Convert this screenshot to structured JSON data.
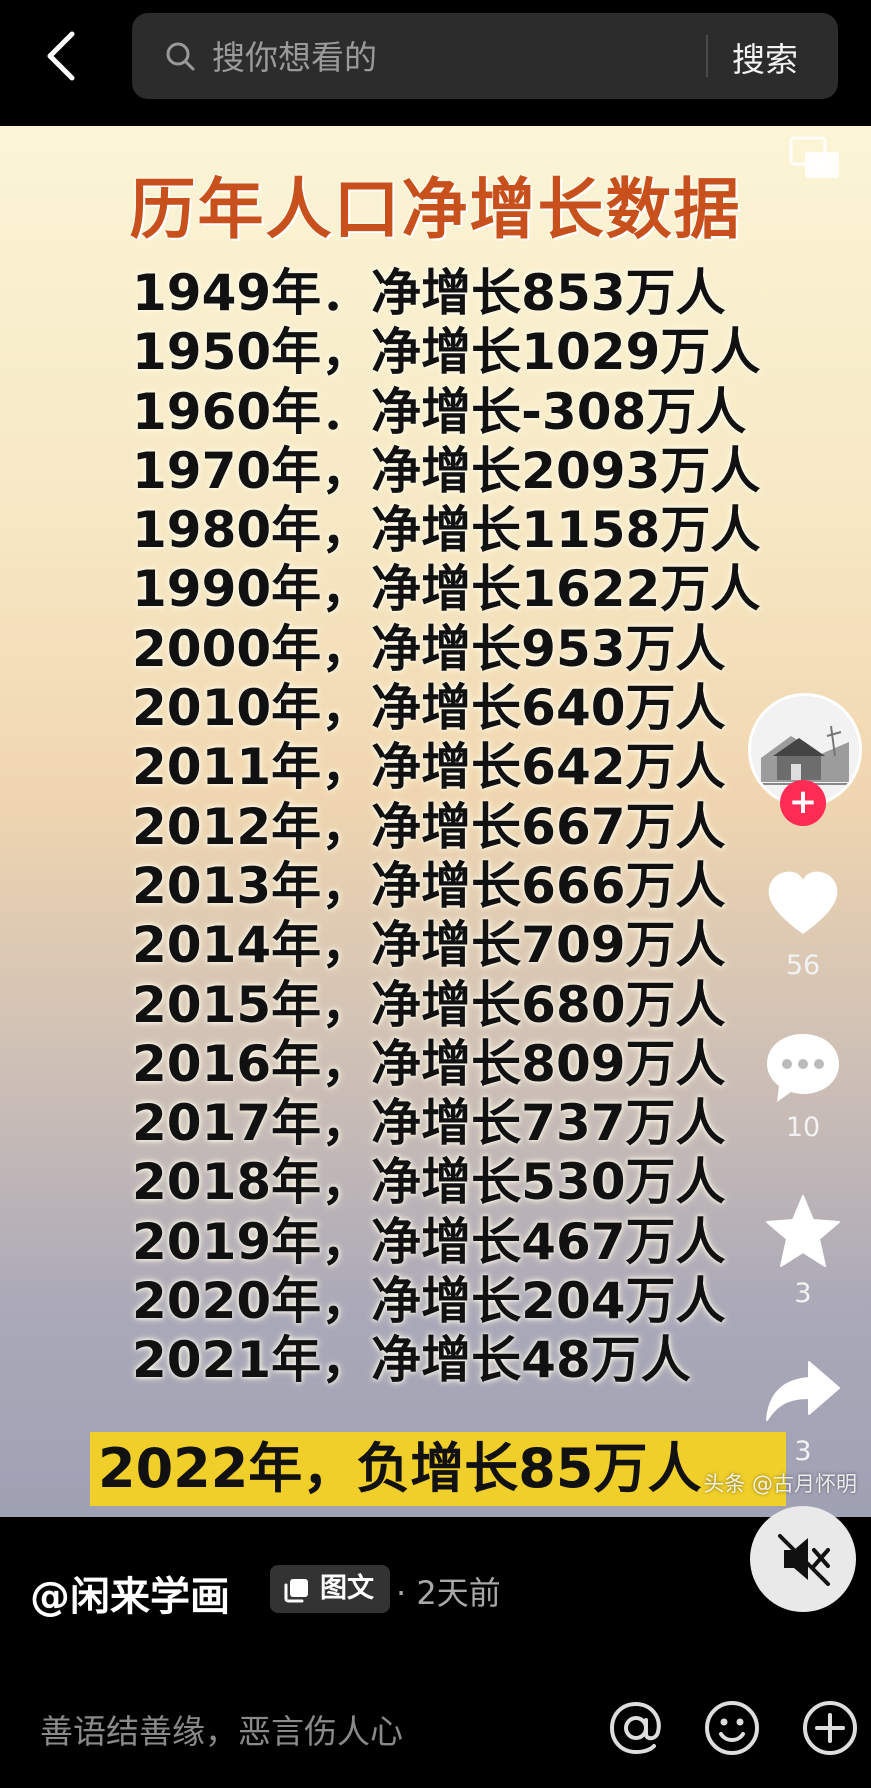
{
  "search": {
    "placeholder": "搜你想看的",
    "button_label": "搜索"
  },
  "image": {
    "headline": "历年人口净增长数据",
    "rows": [
      "1949年．净增长853万人",
      "1950年，净增长1029万人",
      "1960年．净增长-308万人",
      "1970年，净增长2093万人",
      "1980年，净增长1158万人",
      "1990年，净增长1622万人",
      "2000年，净增长953万人",
      "2010年，净增长640万人",
      "2011年，净增长642万人",
      "2012年，净增长667万人",
      "2013年，净增长666万人",
      "2014年，净增长709万人",
      "2015年，净增长680万人",
      "2016年，净增长809万人",
      "2017年，净增长737万人",
      "2018年，净增长530万人",
      "2019年，净增长467万人",
      "2020年，净增长204万人",
      "2021年，净增长48万人"
    ],
    "highlight": "2022年，负增长85万人",
    "watermark": "头条 @古月怀明"
  },
  "rail": {
    "likes": "56",
    "comments": "10",
    "favorites": "3",
    "shares": "3"
  },
  "post": {
    "author": "@闲来学画",
    "tag": "图文",
    "time": "· 2天前"
  },
  "comment": {
    "placeholder": "善语结善缘，恶言伤人心"
  },
  "colors": {
    "follow": "#fe2c55",
    "highlight": "#f0cf2a",
    "headline": "#c7501c"
  },
  "icons": [
    "back-icon",
    "search-icon",
    "gallery-icon",
    "plus-icon",
    "heart-icon",
    "comment-icon",
    "star-icon",
    "share-icon",
    "mute-icon",
    "at-icon",
    "emoji-icon",
    "add-icon",
    "image-text-icon"
  ]
}
